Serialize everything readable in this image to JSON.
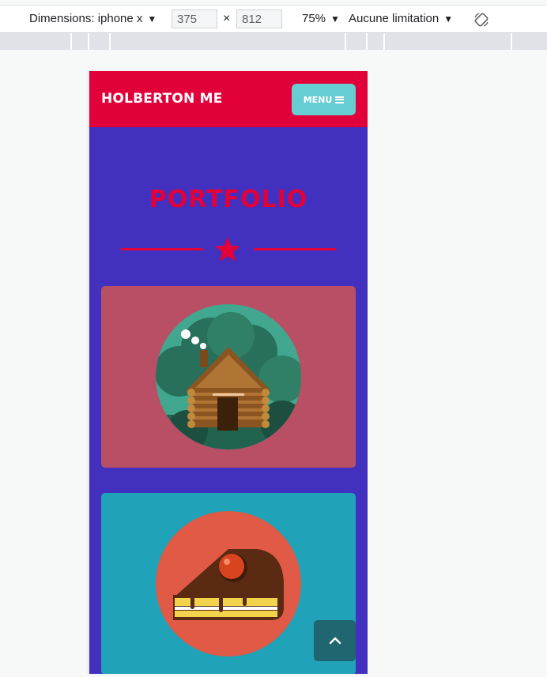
{
  "devtools": {
    "device_label": "Dimensions: iphone x",
    "width_value": "375",
    "times_symbol": "×",
    "height_value": "812",
    "zoom_label": "75%",
    "throttle_label": "Aucune limitation",
    "rotate_icon": "rotate-icon"
  },
  "site": {
    "brand": "HOLBERTON ME",
    "menu_label": "MENU",
    "menu_icon": "hamburger-icon",
    "section_title": "PORTFOLIO",
    "divider_icon": "star-icon",
    "cards": [
      {
        "image": "log-cabin-illustration"
      },
      {
        "image": "cake-slice-illustration"
      }
    ],
    "scroll_top_icon": "chevron-up-icon"
  },
  "colors": {
    "header": "#e2003a",
    "background": "#4230be",
    "menu_button": "#66cdd3",
    "card_1": "#b84f65",
    "card_2": "#20a2b8",
    "scroll_button": "#1f6670"
  }
}
